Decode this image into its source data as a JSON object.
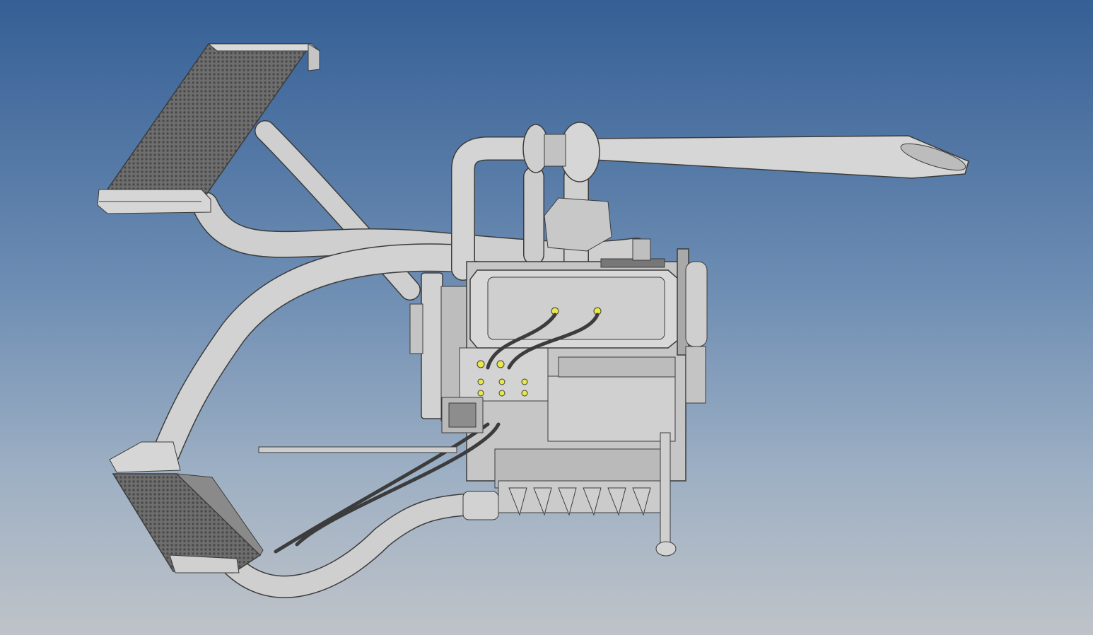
{
  "viewport": {
    "background_top": "#355f95",
    "background_bottom": "#bfc3c8"
  },
  "model": {
    "part_fill": "#c9c9c9",
    "part_fill_light": "#dcdcdc",
    "part_edge": "#3c3c3c",
    "highlight": "#e8e84a",
    "parts": [
      "upper-radiator",
      "lower-oil-cooler",
      "turbocharger",
      "exhaust-tailpipe",
      "engine-block",
      "valve-cover",
      "intake-plenum",
      "timing-belt-pulley",
      "flywheel-housing",
      "coolant-hoses",
      "oil-lines",
      "dipstick",
      "wiring-connector"
    ]
  }
}
